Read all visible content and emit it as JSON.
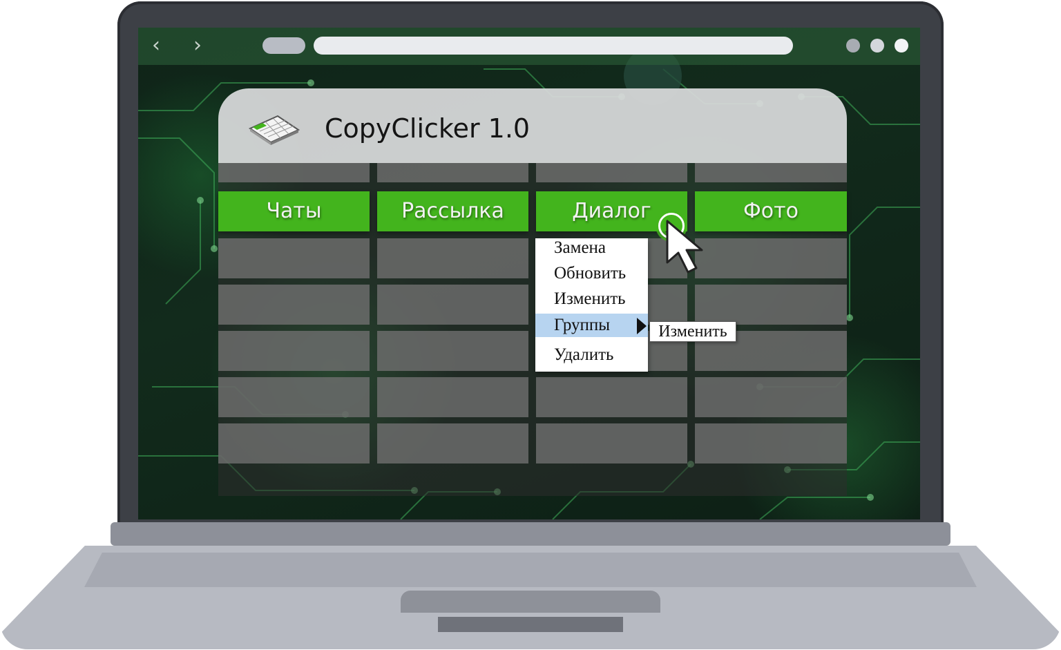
{
  "browser": {
    "back_icon": "chevron-left-icon",
    "forward_icon": "chevron-right-icon",
    "back_glyph": "‹",
    "forward_glyph": "›",
    "url": ""
  },
  "app": {
    "title": "CopyClicker 1.0",
    "icon": "spreadsheet-icon",
    "accent_color": "#43b41d"
  },
  "tabs": [
    {
      "label": "Чаты"
    },
    {
      "label": "Рассылка"
    },
    {
      "label": "Диалог"
    },
    {
      "label": "Фото"
    }
  ],
  "context_menu": {
    "items": [
      {
        "label": "Замена"
      },
      {
        "label": "Обновить"
      },
      {
        "label": "Изменить"
      },
      {
        "label": "Группы",
        "highlighted": true
      },
      {
        "label": "Удалить"
      }
    ],
    "submenu": {
      "label": "Изменить"
    }
  }
}
